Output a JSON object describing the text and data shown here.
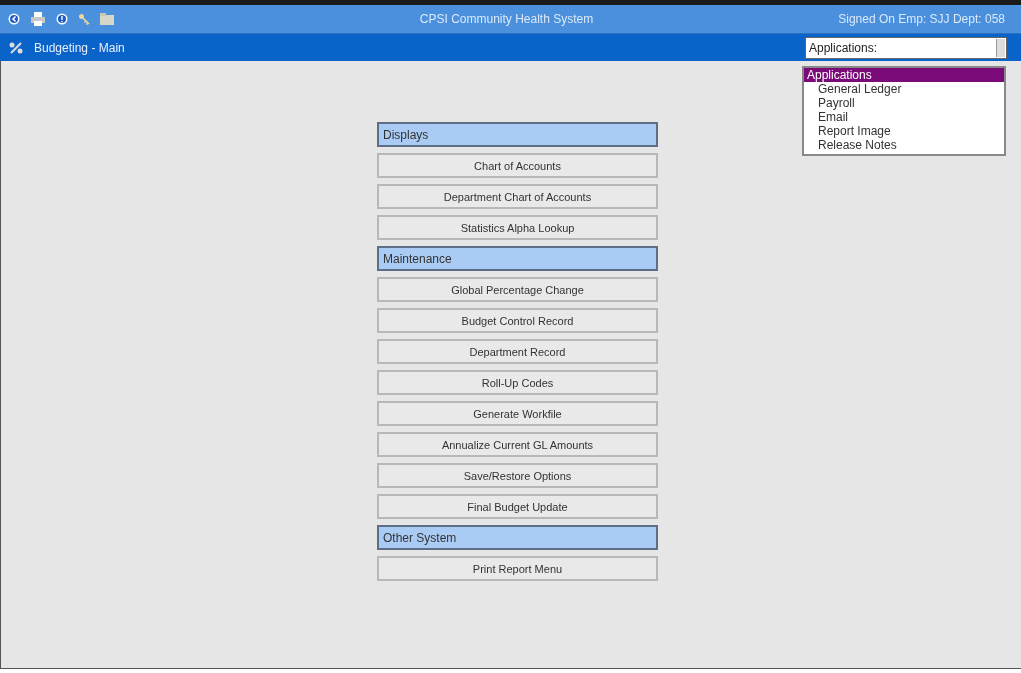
{
  "window": {
    "title": "CPSI Community Health System",
    "signed_on": "Signed On Emp: SJJ  Dept: 058"
  },
  "subtitle": "Budgeting - Main",
  "applications": {
    "value": "Applications:",
    "expanded": true,
    "options": [
      {
        "label": "Applications",
        "selected": true
      },
      {
        "label": "General Ledger",
        "selected": false
      },
      {
        "label": "Payroll",
        "selected": false
      },
      {
        "label": "Email",
        "selected": false
      },
      {
        "label": "Report Image",
        "selected": false
      },
      {
        "label": "Release Notes",
        "selected": false
      }
    ]
  },
  "menu": [
    {
      "kind": "header",
      "label": "Displays"
    },
    {
      "kind": "button",
      "label": "Chart of Accounts"
    },
    {
      "kind": "button",
      "label": "Department Chart of Accounts"
    },
    {
      "kind": "button",
      "label": "Statistics Alpha Lookup"
    },
    {
      "kind": "header",
      "label": "Maintenance"
    },
    {
      "kind": "button",
      "label": "Global Percentage Change"
    },
    {
      "kind": "button",
      "label": "Budget Control Record"
    },
    {
      "kind": "button",
      "label": "Department Record"
    },
    {
      "kind": "button",
      "label": "Roll-Up Codes"
    },
    {
      "kind": "button",
      "label": "Generate Workfile"
    },
    {
      "kind": "button",
      "label": "Annualize Current GL Amounts"
    },
    {
      "kind": "button",
      "label": "Save/Restore Options"
    },
    {
      "kind": "button",
      "label": "Final Budget Update"
    },
    {
      "kind": "header",
      "label": "Other System"
    },
    {
      "kind": "button",
      "label": "Print Report Menu"
    }
  ]
}
